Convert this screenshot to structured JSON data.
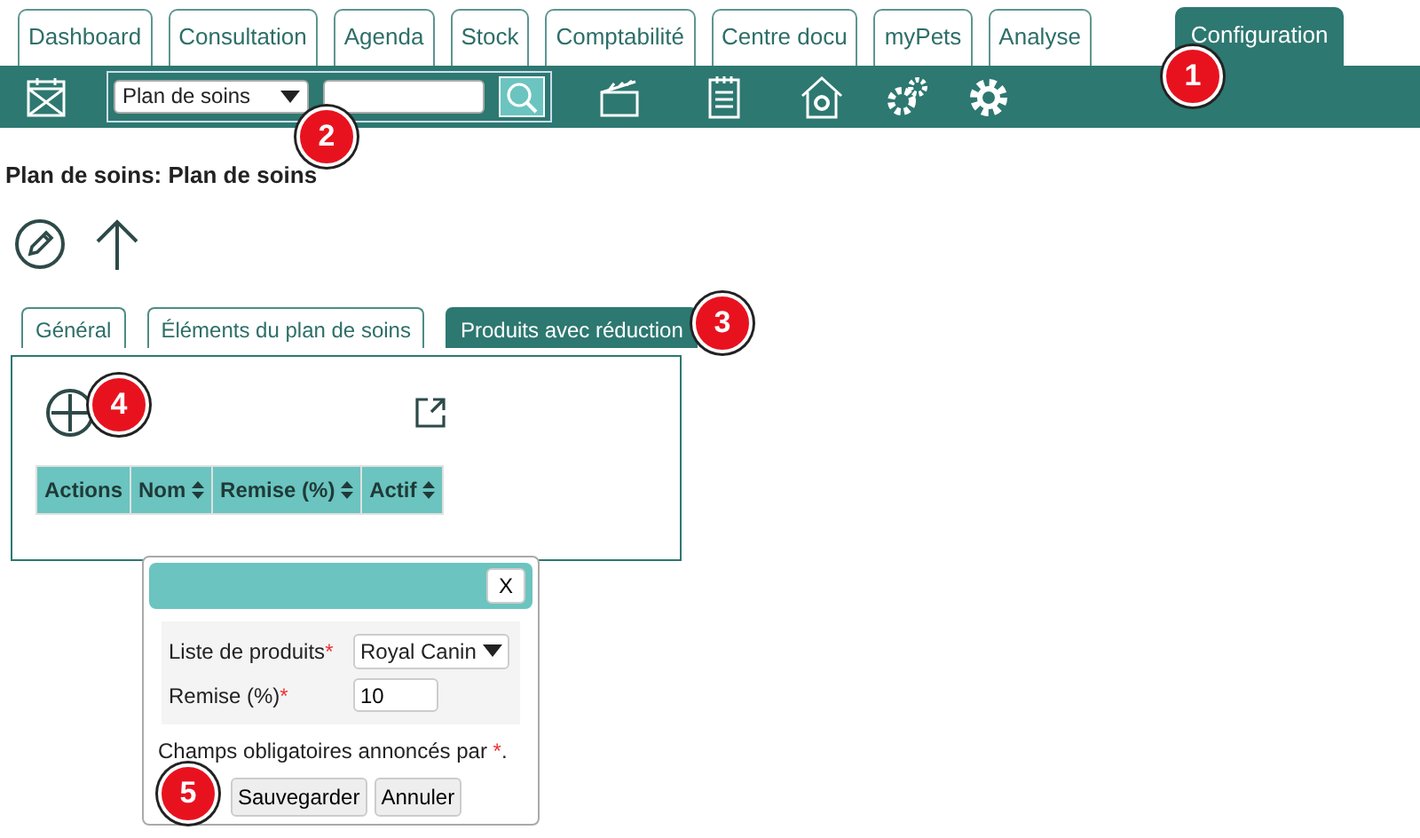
{
  "top_tabs": [
    {
      "label": "Dashboard",
      "selected": false
    },
    {
      "label": "Consultation",
      "selected": false
    },
    {
      "label": "Agenda",
      "selected": false
    },
    {
      "label": "Stock",
      "selected": false
    },
    {
      "label": "Comptabilité",
      "selected": false
    },
    {
      "label": "Centre docu",
      "selected": false
    },
    {
      "label": "myPets",
      "selected": false
    },
    {
      "label": "Analyse",
      "selected": false
    },
    {
      "label": "Configuration",
      "selected": true
    }
  ],
  "toolbar": {
    "search_select": "Plan de soins"
  },
  "page_title": "Plan de soins: Plan de soins",
  "sub_tabs": [
    {
      "label": "Général",
      "selected": false
    },
    {
      "label": "Éléments du plan de soins",
      "selected": false
    },
    {
      "label": "Produits avec réduction",
      "selected": true
    }
  ],
  "table": {
    "columns": [
      {
        "label": "Actions",
        "sortable": false
      },
      {
        "label": "Nom",
        "sortable": true
      },
      {
        "label": "Remise (%)",
        "sortable": true
      },
      {
        "label": "Actif",
        "sortable": true
      }
    ]
  },
  "dialog": {
    "close": "X",
    "fields": [
      {
        "label": "Liste de produits",
        "required": true,
        "kind": "select",
        "value": "Royal Canin"
      },
      {
        "label": "Remise (%)",
        "required": true,
        "kind": "input",
        "value": "10"
      }
    ],
    "note": {
      "text": "Champs obligatoires annoncés par ",
      "mark": "*",
      "end": "."
    },
    "buttons": [
      "Sauvegarder",
      "Annuler"
    ]
  },
  "callouts": [
    {
      "label": "1"
    },
    {
      "label": "2"
    },
    {
      "label": "3"
    },
    {
      "label": "4"
    },
    {
      "label": "5"
    }
  ]
}
